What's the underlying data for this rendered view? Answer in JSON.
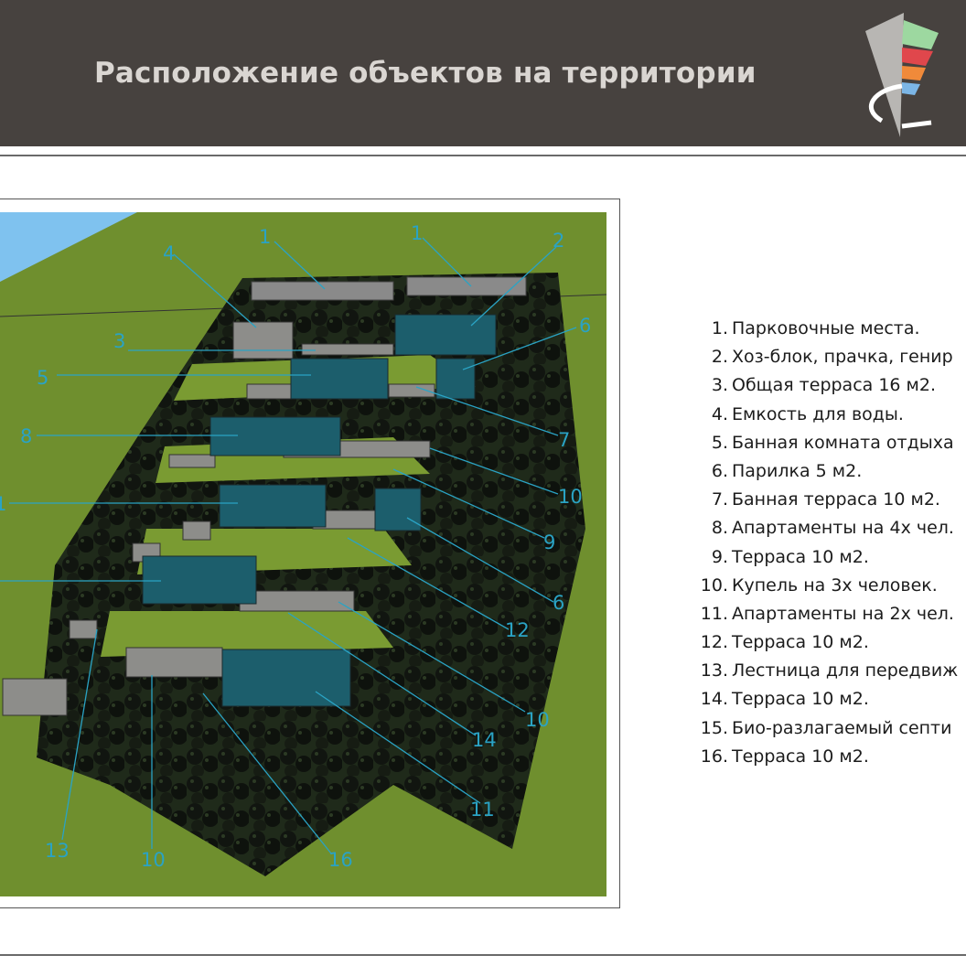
{
  "slide": {
    "title": "Расположение объектов на территории",
    "colors": {
      "header_bg": "#47423f",
      "title": "#dad6d2",
      "label_cyan": "#2aa3c4",
      "grass": "#6f8f2e"
    }
  },
  "logo": {
    "icon": "triangle-stripes-logo"
  },
  "plan": {
    "labels": [
      "1",
      "1",
      "2",
      "3",
      "4",
      "5",
      "6",
      "7",
      "8",
      "9",
      "10",
      "1",
      "6",
      "12",
      "10",
      "14",
      "11",
      "16",
      "10",
      "13"
    ]
  },
  "legend": {
    "items": [
      {
        "num": "1.",
        "text": "Парковочные места."
      },
      {
        "num": "2.",
        "text": "Хоз-блок, прачка, генир"
      },
      {
        "num": "3.",
        "text": "Общая терраса  16 м2."
      },
      {
        "num": "4.",
        "text": "Емкость для воды."
      },
      {
        "num": "5.",
        "text": "Банная комната отдыха"
      },
      {
        "num": "6.",
        "text": "Парилка  5 м2."
      },
      {
        "num": "7.",
        "text": "Банная терраса  10 м2."
      },
      {
        "num": "8.",
        "text": "Апартаменты на 4х чел."
      },
      {
        "num": "9.",
        "text": "Терраса   10 м2."
      },
      {
        "num": "10.",
        "text": "Купель на 3х человек."
      },
      {
        "num": "11.",
        "text": "Апартаменты на 2х чел."
      },
      {
        "num": "12.",
        "text": "Терраса  10 м2."
      },
      {
        "num": "13.",
        "text": "Лестница для передвиж"
      },
      {
        "num": "14.",
        "text": "Терраса  10 м2."
      },
      {
        "num": "15.",
        "text": "Био-разлагаемый септи"
      },
      {
        "num": "16.",
        "text": "Терраса 10 м2."
      }
    ]
  }
}
